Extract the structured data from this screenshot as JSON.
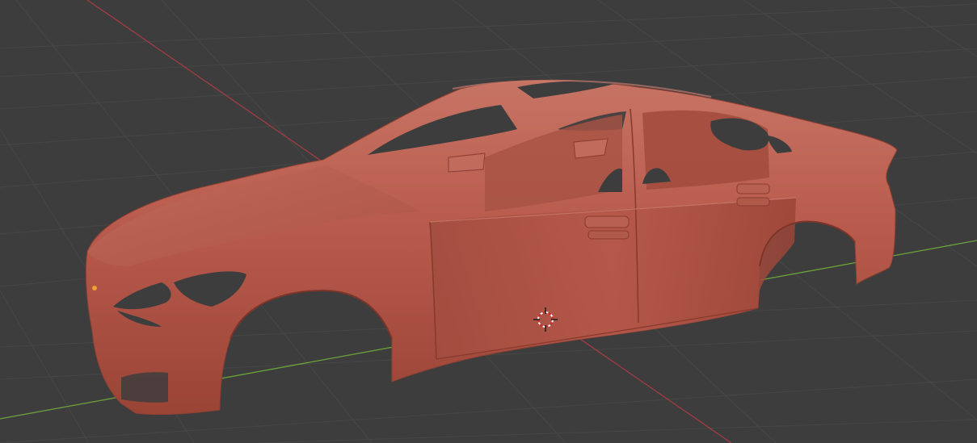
{
  "viewport": {
    "background_color": "#3d3d3d",
    "grid_color": "#4a4a4a",
    "x_axis_color": "#a33c45",
    "y_axis_color": "#6ba33a",
    "model_color": "#b85a4c",
    "model_shadow_color": "#8a3b30",
    "model_highlight_color": "#cf7b6c",
    "cursor_icon": "3d-cursor-icon",
    "origin_icon": "origin-dot-icon"
  }
}
